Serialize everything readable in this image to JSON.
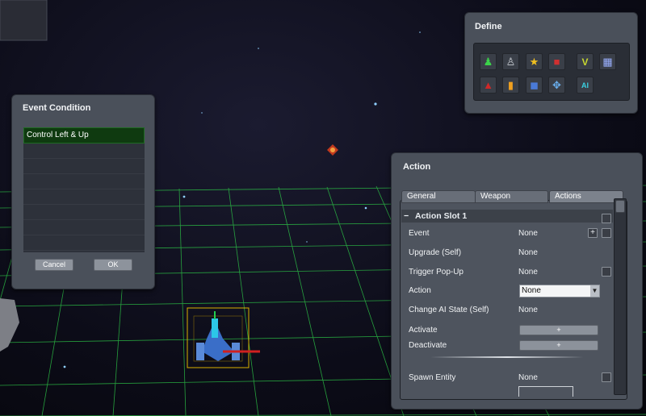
{
  "event_condition": {
    "title": "Event Condition",
    "items": [
      "Control Left & Up",
      "",
      "",
      "",
      "",
      "",
      "",
      ""
    ],
    "cancel_label": "Cancel",
    "ok_label": "OK"
  },
  "define": {
    "title": "Define",
    "icons": [
      "green-soldier-icon",
      "robot-icon",
      "star-badge-icon",
      "red-gamepad-icon",
      "v-letter-icon",
      "grid-panel-icon",
      "red-mushroom-icon",
      "bullet-icon",
      "shield-icon",
      "crosshair-icon",
      "ai-text-icon"
    ],
    "ai_icon_text": "AI",
    "v_icon_text": "V"
  },
  "action": {
    "title": "Action",
    "tabs": [
      "General",
      "Weapon",
      "Actions"
    ],
    "active_tab": "Actions",
    "slot_title": "Action Slot 1",
    "collapse_glyph": "−",
    "rows": {
      "event": {
        "label": "Event",
        "value": "None"
      },
      "upgrade": {
        "label": "Upgrade (Self)",
        "value": "None"
      },
      "trigger_popup": {
        "label": "Trigger Pop-Up",
        "value": "None"
      },
      "action": {
        "label": "Action",
        "value": "None"
      },
      "change_ai": {
        "label": "Change AI State (Self)",
        "value": "None"
      },
      "activate": {
        "label": "Activate",
        "value": "+"
      },
      "deactivate": {
        "label": "Deactivate",
        "value": "+"
      },
      "spawn_entity": {
        "label": "Spawn Entity",
        "value": "None"
      }
    },
    "plus_glyph": "+",
    "dropdown_arrow": "▼"
  },
  "colors": {
    "grid": "#2fd24a",
    "panel": "#4a505a",
    "selected_row": "#0f3a10"
  }
}
